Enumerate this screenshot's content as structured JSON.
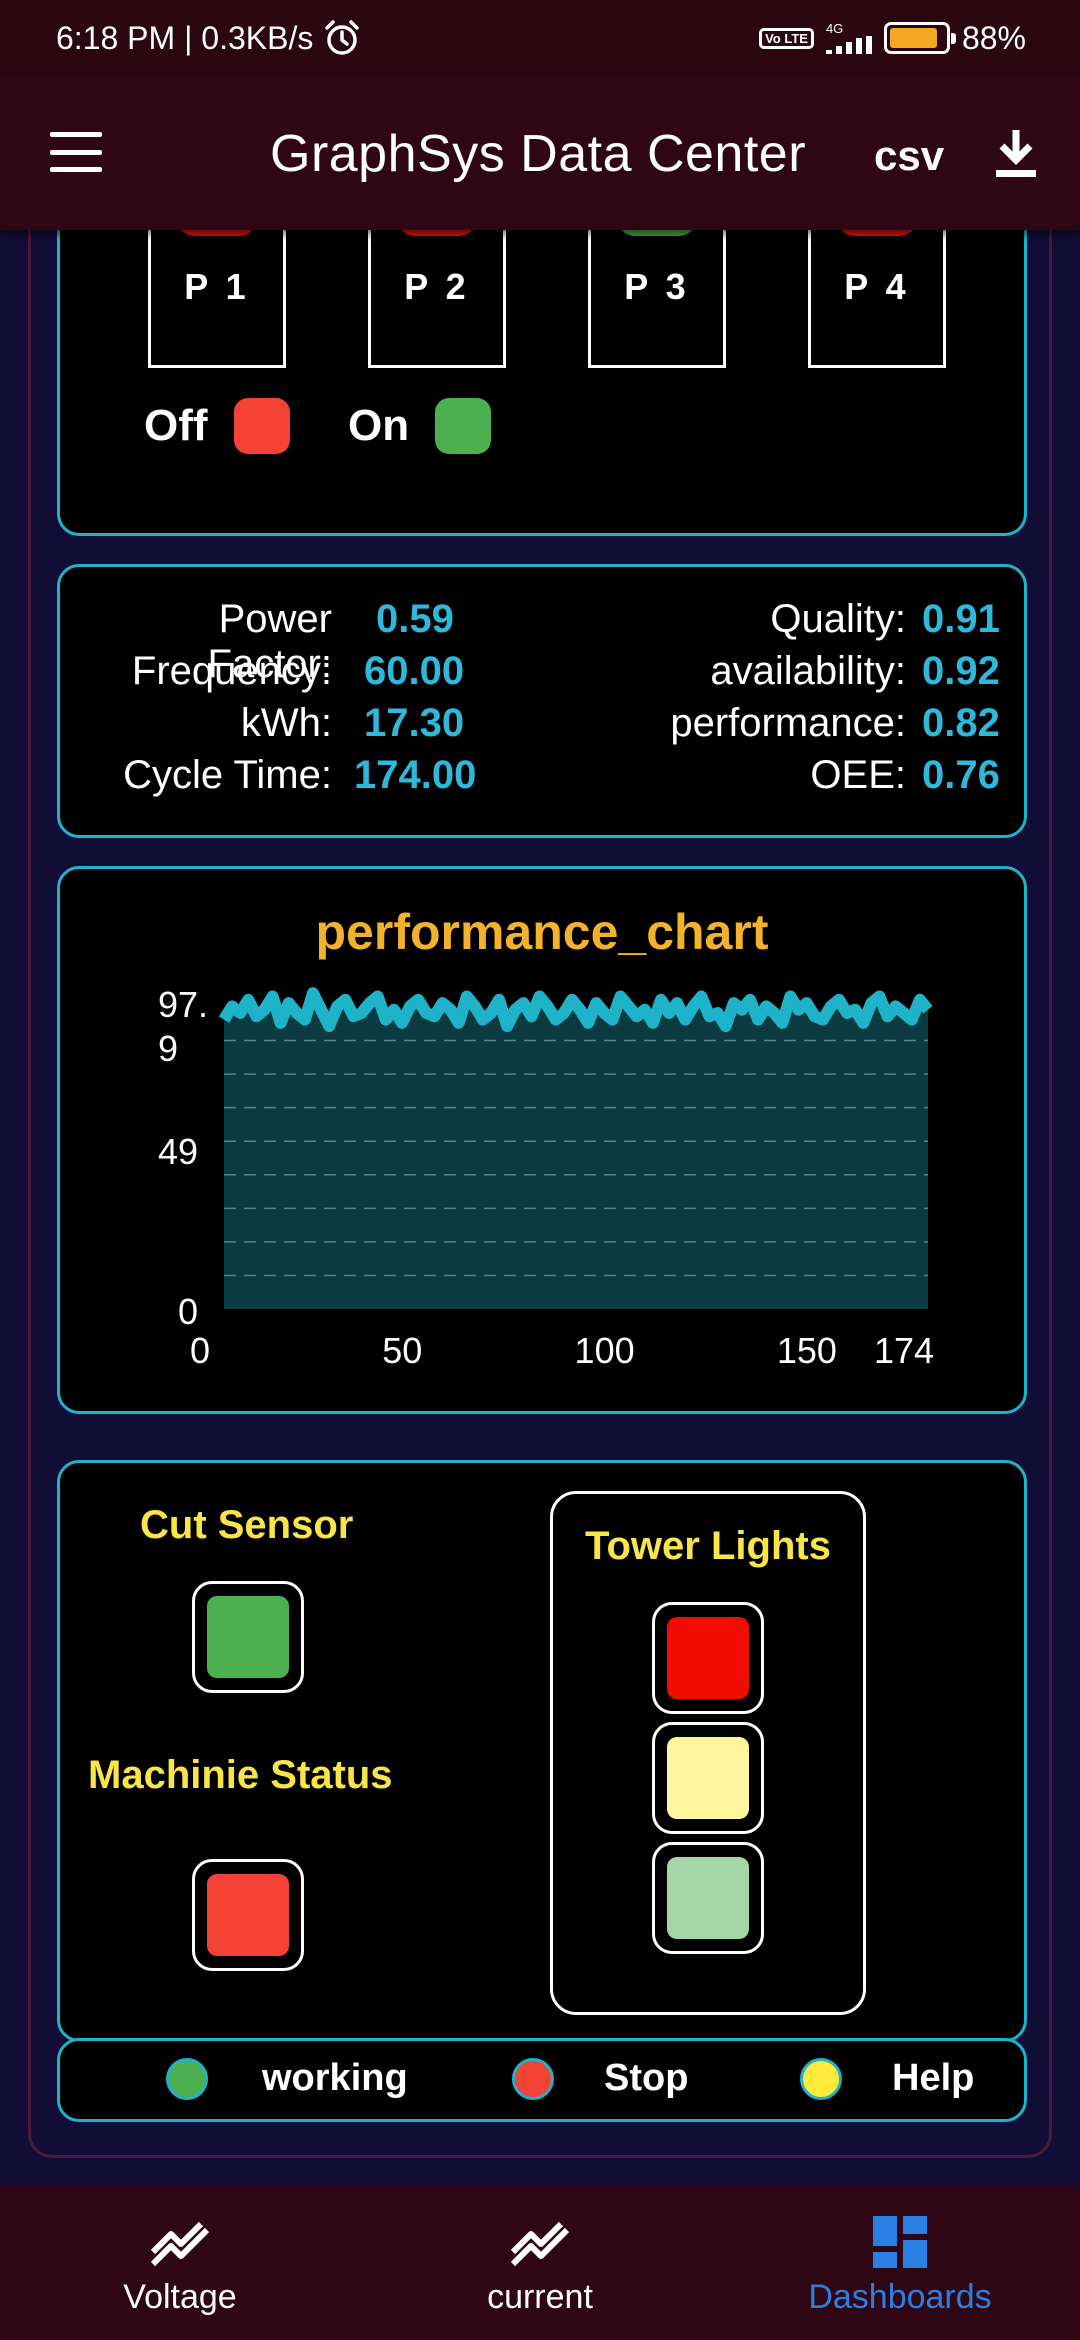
{
  "status_bar": {
    "time": "6:18 PM | 0.3KB/s",
    "volte": "Vo LTE",
    "network": "4G",
    "battery": "88%",
    "battery_level": 0.88
  },
  "app_bar": {
    "title": "GraphSys Data Center",
    "csv_label": "csv"
  },
  "pumps": [
    {
      "label": "P 1",
      "color": "#e8120c"
    },
    {
      "label": "P 2",
      "color": "#e8120c"
    },
    {
      "label": "P 3",
      "color": "#45a843"
    },
    {
      "label": "P 4",
      "color": "#e8120c"
    }
  ],
  "pump_legend": {
    "off_label": "Off",
    "off_color": "#f44336",
    "on_label": "On",
    "on_color": "#4caf50"
  },
  "metrics_left": [
    {
      "label": "Power Factor:",
      "value": "0.59"
    },
    {
      "label": "Frequency:",
      "value": "60.00"
    },
    {
      "label": "kWh:",
      "value": "17.30"
    },
    {
      "label": "Cycle Time:",
      "value": "174.00"
    }
  ],
  "metrics_right": [
    {
      "label": "Quality:",
      "value": "0.91"
    },
    {
      "label": "availability:",
      "value": "0.92"
    },
    {
      "label": "performance:",
      "value": "0.82"
    },
    {
      "label": "OEE:",
      "value": "0.76"
    }
  ],
  "chart_data": {
    "type": "area",
    "title": "performance_chart",
    "xlabel": "",
    "ylabel": "",
    "xlim": [
      0,
      174
    ],
    "ylim": [
      0,
      97.9
    ],
    "x_ticks": [
      "0",
      "50",
      "100",
      "150",
      "174"
    ],
    "y_ticks": [
      "0",
      "49",
      "97.\n9"
    ],
    "grid": true,
    "series": [
      {
        "color": "#1fb3c9",
        "x_step": 2,
        "values": [
          88,
          92,
          90,
          94,
          89,
          91,
          95,
          87,
          93,
          90,
          88,
          96,
          91,
          86,
          92,
          94,
          89,
          90,
          93,
          95,
          88,
          91,
          87,
          92,
          94,
          90,
          89,
          93,
          91,
          87,
          95,
          92,
          88,
          90,
          94,
          86,
          91,
          93,
          89,
          95,
          92,
          88,
          90,
          94,
          91,
          87,
          93,
          90,
          88,
          95,
          92,
          89,
          91,
          87,
          94,
          90,
          93,
          88,
          92,
          95,
          89,
          90,
          86,
          93,
          91,
          94,
          88,
          92,
          90,
          87,
          95,
          91,
          93,
          89,
          88,
          92,
          94,
          90,
          91,
          87,
          93,
          95,
          89,
          92,
          90,
          88,
          94,
          91
        ]
      }
    ]
  },
  "sensors": {
    "cut_sensor_label": "Cut Sensor",
    "cut_sensor_color": "#4caf50",
    "machine_status_label": "Machinie Status",
    "machine_status_color": "#f44336",
    "tower_lights_label": "Tower Lights",
    "tower_colors": [
      "#f20c00",
      "#fff59d",
      "#a5d6a7"
    ]
  },
  "status_legend": [
    {
      "label": "working",
      "color": "#4caf50"
    },
    {
      "label": "Stop",
      "color": "#f44336"
    },
    {
      "label": "Help",
      "color": "#ffeb3b"
    }
  ],
  "bottom_nav": [
    {
      "label": "Voltage",
      "icon": "trend-icon",
      "active": false
    },
    {
      "label": "current",
      "icon": "trend-icon",
      "active": false
    },
    {
      "label": "Dashboards",
      "icon": "dashboard-icon",
      "active": true
    }
  ]
}
